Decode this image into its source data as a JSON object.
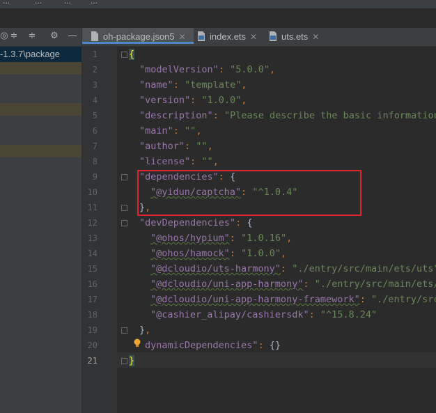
{
  "menu": [
    "...",
    "...",
    "...",
    "..."
  ],
  "sidebar": {
    "toolbar_icons": [
      "target-icon",
      "collapse-icon",
      "expand-icon",
      "gear-icon",
      "minimize-icon"
    ],
    "path_label": "-1.3.7\\package"
  },
  "tabs": [
    {
      "label": "oh-package.json5",
      "active": true,
      "icon": "json-file-icon"
    },
    {
      "label": "index.ets",
      "active": false,
      "icon": "ets-file-icon"
    },
    {
      "label": "uts.ets",
      "active": false,
      "icon": "ets-file-icon"
    }
  ],
  "gutter": {
    "line_numbers": [
      "1",
      "2",
      "3",
      "4",
      "5",
      "6",
      "7",
      "8",
      "9",
      "10",
      "11",
      "12",
      "13",
      "14",
      "15",
      "16",
      "17",
      "18",
      "19",
      "20",
      "21"
    ],
    "current_line": "21"
  },
  "code": {
    "l1": "{",
    "l2_key": "\"modelVersion\"",
    "l2_val": "\"5.0.0\"",
    "l3_key": "\"name\"",
    "l3_val": "\"template\"",
    "l4_key": "\"version\"",
    "l4_val": "\"1.0.0\"",
    "l5_key": "\"description\"",
    "l5_val": "\"Please describe the basic information",
    "l6_key": "\"main\"",
    "l6_val": "\"\"",
    "l7_key": "\"author\"",
    "l7_val": "\"\"",
    "l8_key": "\"license\"",
    "l8_val": "\"\"",
    "l9_key": "\"dependencies\"",
    "l10_key": "\"@yidun/captcha\"",
    "l10_val": "\"^1.0.4\"",
    "l11": "}",
    "l12_key": "\"devDependencies\"",
    "l13_key": "\"@ohos/hypium\"",
    "l13_val": "\"1.0.16\"",
    "l14_key": "\"@ohos/hamock\"",
    "l14_val": "\"1.0.0\"",
    "l15_key": "\"@dcloudio/uts-harmony\"",
    "l15_val": "\"./entry/src/main/ets/uts\"",
    "l16_key": "\"@dcloudio/uni-app-harmony\"",
    "l16_val": "\"./entry/src/main/ets/u",
    "l17_key": "\"@dcloudio/uni-app-harmony-framework\"",
    "l17_val": "\"./entry/src/",
    "l18_key": "\"@cashier_alipay/cashiersdk\"",
    "l18_val": "\"^15.8.24\"",
    "l19": "}",
    "l20_key": "dynamicDependencies\"",
    "l20_val": "{}",
    "l21": "}"
  },
  "colors": {
    "background": "#2b2b2b",
    "key": "#9876aa",
    "string": "#6a8759",
    "punct": "#cc7832",
    "annotation_box": "#e0242e"
  }
}
